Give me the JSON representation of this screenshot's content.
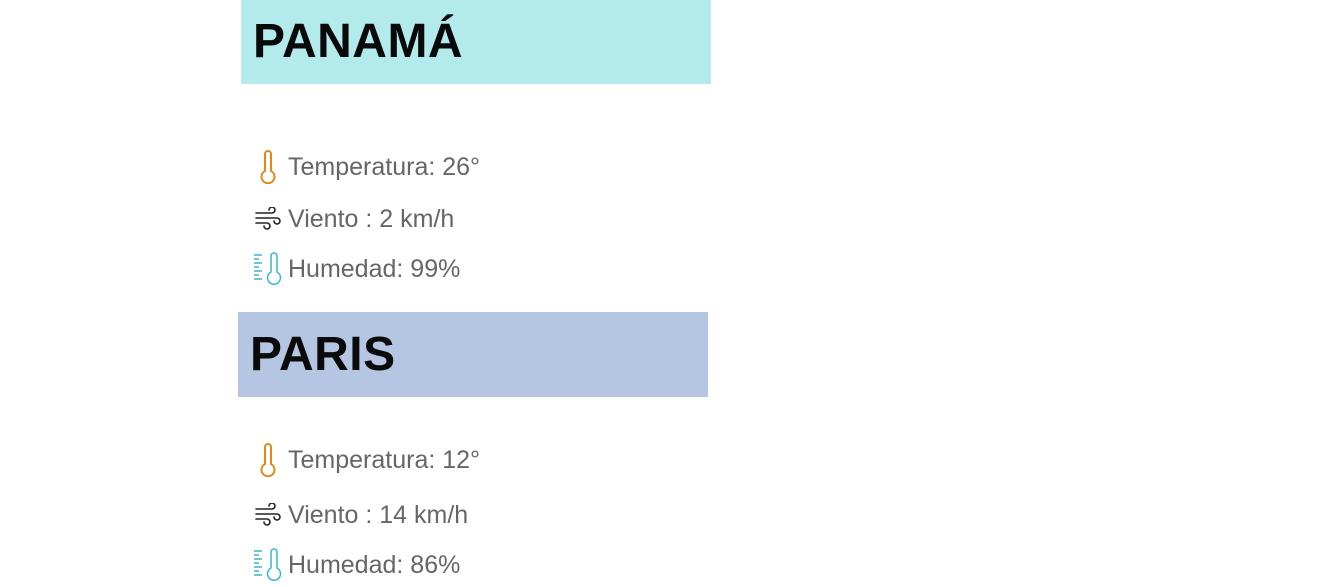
{
  "cities": [
    {
      "name": "PANAMÁ",
      "header_color": "#b3eaec",
      "temperature": "Temperatura: 26°",
      "wind": "Viento : 2 km/h",
      "humidity": "Humedad: 99%"
    },
    {
      "name": "PARIS",
      "header_color": "#b5c6e3",
      "temperature": "Temperatura: 12°",
      "wind": "Viento : 14 km/h",
      "humidity": "Humedad: 86%"
    }
  ],
  "icons": {
    "temperature": "thermometer-icon",
    "wind": "wind-icon",
    "humidity": "humidity-icon"
  },
  "colors": {
    "thermometer": "#e08a1e",
    "wind": "#222222",
    "humidity": "#3bb6c9",
    "stat_text": "#666666"
  }
}
